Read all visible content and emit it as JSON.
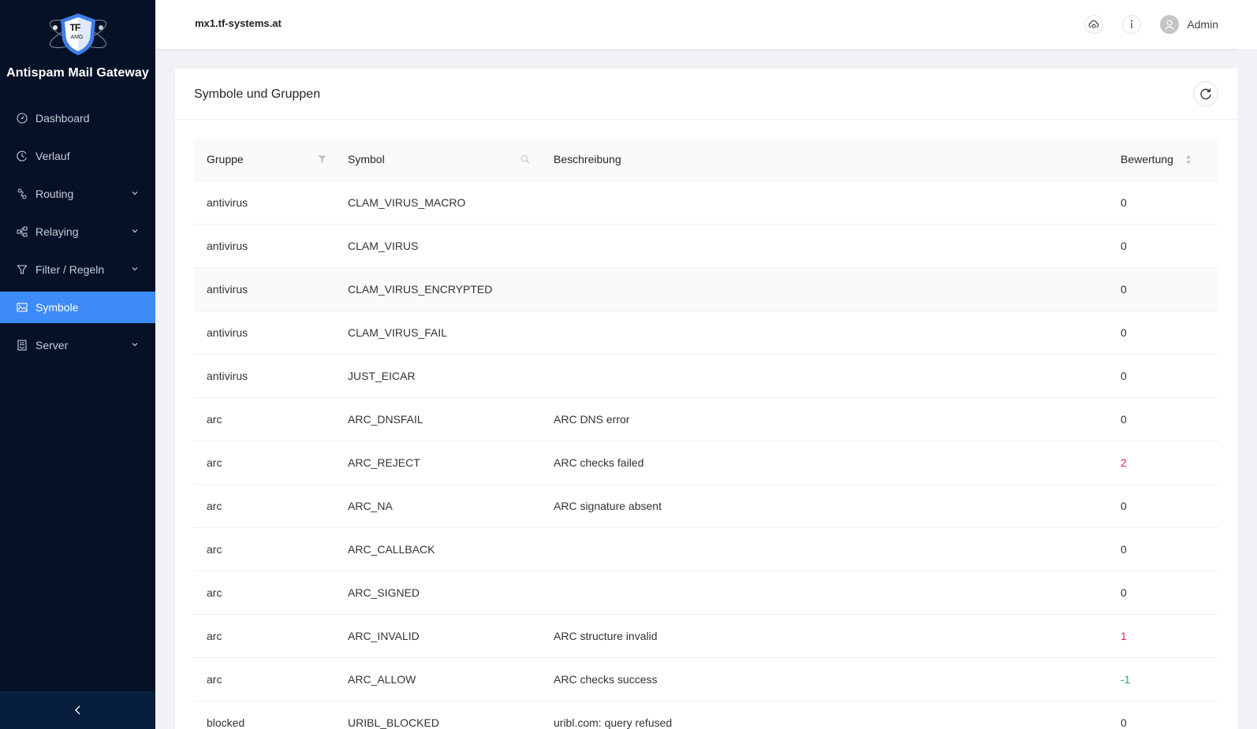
{
  "app": {
    "brand": "Antispam Mail Gateway",
    "logo_text": "TF",
    "logo_subtext": "AMG"
  },
  "sidebar": {
    "items": [
      {
        "label": "Dashboard",
        "icon": "dashboard-icon",
        "has_children": false,
        "active": false
      },
      {
        "label": "Verlauf",
        "icon": "history-icon",
        "has_children": false,
        "active": false
      },
      {
        "label": "Routing",
        "icon": "routing-icon",
        "has_children": true,
        "active": false
      },
      {
        "label": "Relaying",
        "icon": "relaying-icon",
        "has_children": true,
        "active": false
      },
      {
        "label": "Filter / Regeln",
        "icon": "filter-icon",
        "has_children": true,
        "active": false
      },
      {
        "label": "Symbole",
        "icon": "image-icon",
        "has_children": false,
        "active": true
      },
      {
        "label": "Server",
        "icon": "server-icon",
        "has_children": true,
        "active": false
      }
    ],
    "collapse_icon": "chevron-left-icon"
  },
  "topbar": {
    "hostname": "mx1.tf-systems.at",
    "user": "Admin",
    "icons": [
      "cloud-sync-icon",
      "info-icon",
      "user-avatar-icon"
    ]
  },
  "page": {
    "title": "Symbole und Gruppen",
    "refresh_icon": "reload-icon"
  },
  "table": {
    "columns": [
      {
        "label": "Gruppe",
        "icon": "filter-icon"
      },
      {
        "label": "Symbol",
        "icon": "search-icon"
      },
      {
        "label": "Beschreibung",
        "icon": ""
      },
      {
        "label": "Bewertung",
        "icon": "sort-icon"
      }
    ],
    "rows": [
      {
        "group": "antivirus",
        "symbol": "CLAM_VIRUS_MACRO",
        "description": "",
        "score": "0"
      },
      {
        "group": "antivirus",
        "symbol": "CLAM_VIRUS",
        "description": "",
        "score": "0"
      },
      {
        "group": "antivirus",
        "symbol": "CLAM_VIRUS_ENCRYPTED",
        "description": "",
        "score": "0",
        "hover": true
      },
      {
        "group": "antivirus",
        "symbol": "CLAM_VIRUS_FAIL",
        "description": "",
        "score": "0"
      },
      {
        "group": "antivirus",
        "symbol": "JUST_EICAR",
        "description": "",
        "score": "0"
      },
      {
        "group": "arc",
        "symbol": "ARC_DNSFAIL",
        "description": "ARC DNS error",
        "score": "0"
      },
      {
        "group": "arc",
        "symbol": "ARC_REJECT",
        "description": "ARC checks failed",
        "score": "2"
      },
      {
        "group": "arc",
        "symbol": "ARC_NA",
        "description": "ARC signature absent",
        "score": "0"
      },
      {
        "group": "arc",
        "symbol": "ARC_CALLBACK",
        "description": "",
        "score": "0"
      },
      {
        "group": "arc",
        "symbol": "ARC_SIGNED",
        "description": "",
        "score": "0"
      },
      {
        "group": "arc",
        "symbol": "ARC_INVALID",
        "description": "ARC structure invalid",
        "score": "1"
      },
      {
        "group": "arc",
        "symbol": "ARC_ALLOW",
        "description": "ARC checks success",
        "score": "-1"
      },
      {
        "group": "blocked",
        "symbol": "URIBL_BLOCKED",
        "description": "uribl.com: query refused",
        "score": "0"
      }
    ]
  },
  "colors": {
    "sidebar_bg": "#041127",
    "active_item": "#3d8bf8",
    "positive_score": "#e8254a",
    "negative_score": "#2b9a9a"
  }
}
